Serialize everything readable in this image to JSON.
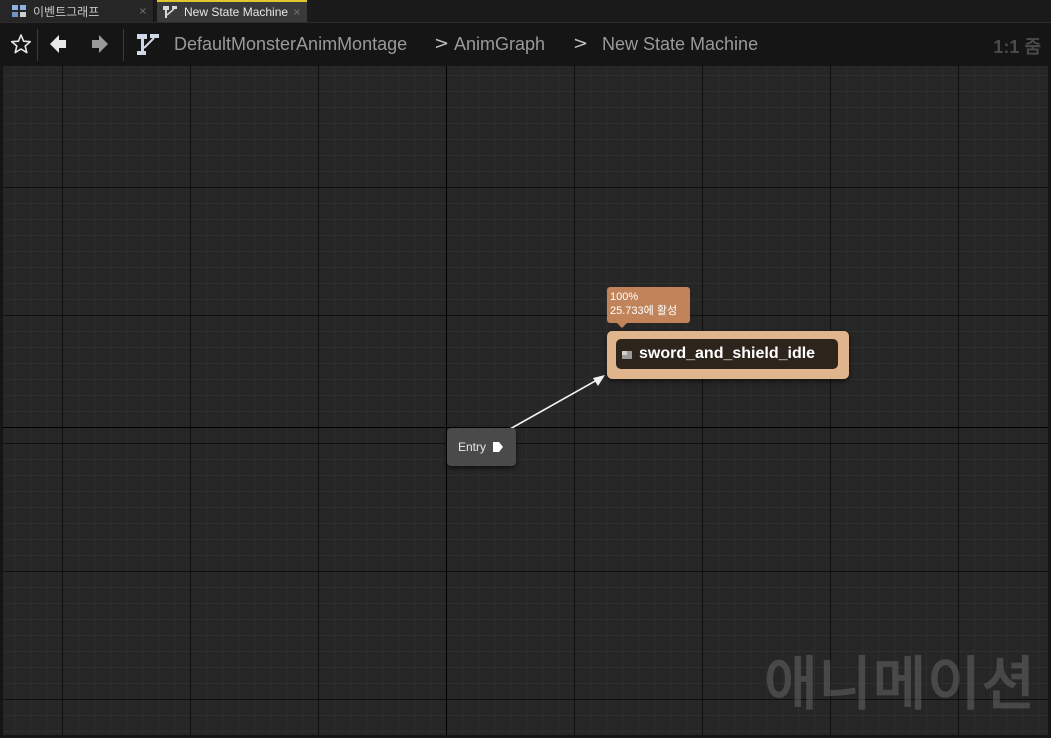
{
  "tabs": [
    {
      "label": "이벤트그래프",
      "icon": "event-graph-icon",
      "active": false,
      "close": "×"
    },
    {
      "label": "New State Machine",
      "icon": "state-machine-icon",
      "active": true,
      "close": "×"
    }
  ],
  "toolbar": {
    "favorite_icon": "star-icon",
    "back_icon": "arrow-left-icon",
    "forward_icon": "arrow-right-icon",
    "graph_icon": "state-machine-icon",
    "breadcrumb": [
      "DefaultMonsterAnimMontage",
      "AnimGraph",
      "New State Machine"
    ],
    "separator": ">",
    "zoom": "1:1 줌"
  },
  "graph": {
    "entry_label": "Entry",
    "state": {
      "title": "sword_and_shield_idle",
      "weight": "100%",
      "active_text": "25.733에 활성"
    },
    "watermark": "애니메이션"
  },
  "colors": {
    "state_border": "#e0b48c",
    "state_body": "#2d241c",
    "bubble": "#c1845a",
    "active_tab_accent": "#e0c631",
    "entry_node": "#4a4a4a"
  }
}
